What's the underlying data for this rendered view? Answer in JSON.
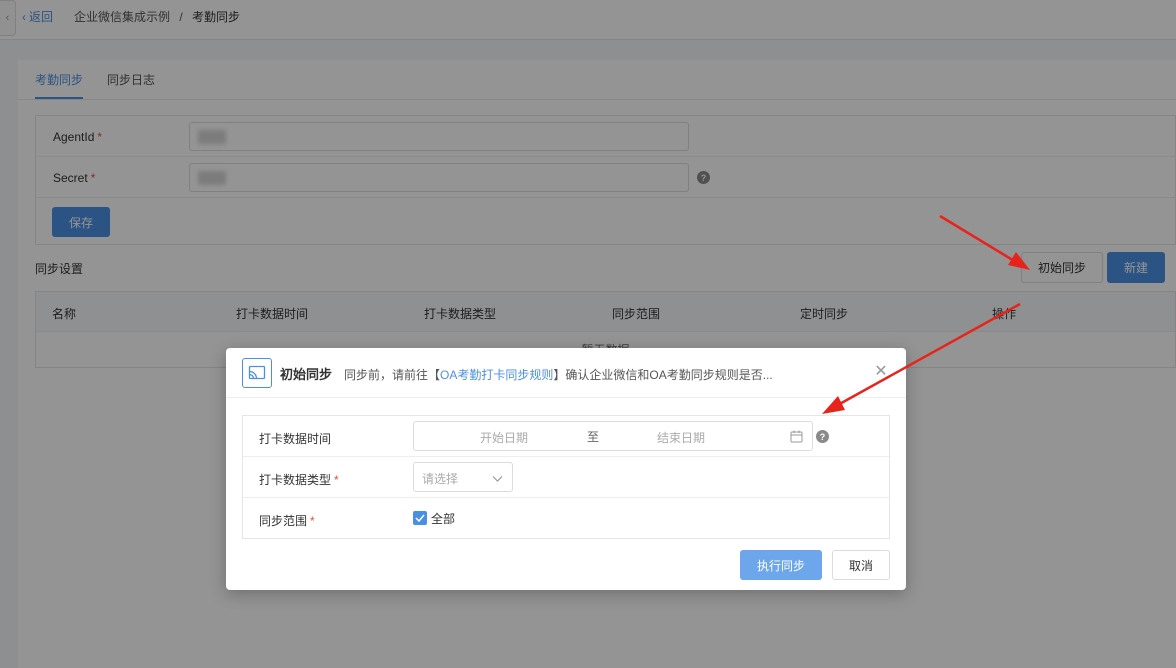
{
  "breadcrumb": {
    "back_label": "返回",
    "parent": "企业微信集成示例",
    "separator": "/",
    "current": "考勤同步"
  },
  "tabs": [
    {
      "label": "考勤同步",
      "active": true
    },
    {
      "label": "同步日志",
      "active": false
    }
  ],
  "config_form": {
    "agentid_label": "AgentId",
    "secret_label": "Secret",
    "required_mark": "*",
    "save_label": "保存"
  },
  "sync_section": {
    "title": "同步设置",
    "init_sync_label": "初始同步",
    "new_label": "新建",
    "columns": [
      "名称",
      "打卡数据时间",
      "打卡数据类型",
      "同步范围",
      "定时同步",
      "操作"
    ],
    "empty_text": "暂无数据"
  },
  "dialog": {
    "title": "初始同步",
    "desc_prefix": "同步前，请前往【",
    "desc_link": "OA考勤打卡同步规则",
    "desc_suffix": "】确认企业微信和OA考勤同步规则是否...",
    "fields": {
      "time_label": "打卡数据时间",
      "start_placeholder": "开始日期",
      "range_separator": "至",
      "end_placeholder": "结束日期",
      "type_label": "打卡数据类型",
      "type_placeholder": "请选择",
      "scope_label": "同步范围",
      "scope_option": "全部",
      "scope_checked": true
    },
    "execute_label": "执行同步",
    "cancel_label": "取消"
  },
  "colors": {
    "primary": "#4a90e2",
    "required": "#e84c3d",
    "annotation_arrow": "#e8231b"
  }
}
